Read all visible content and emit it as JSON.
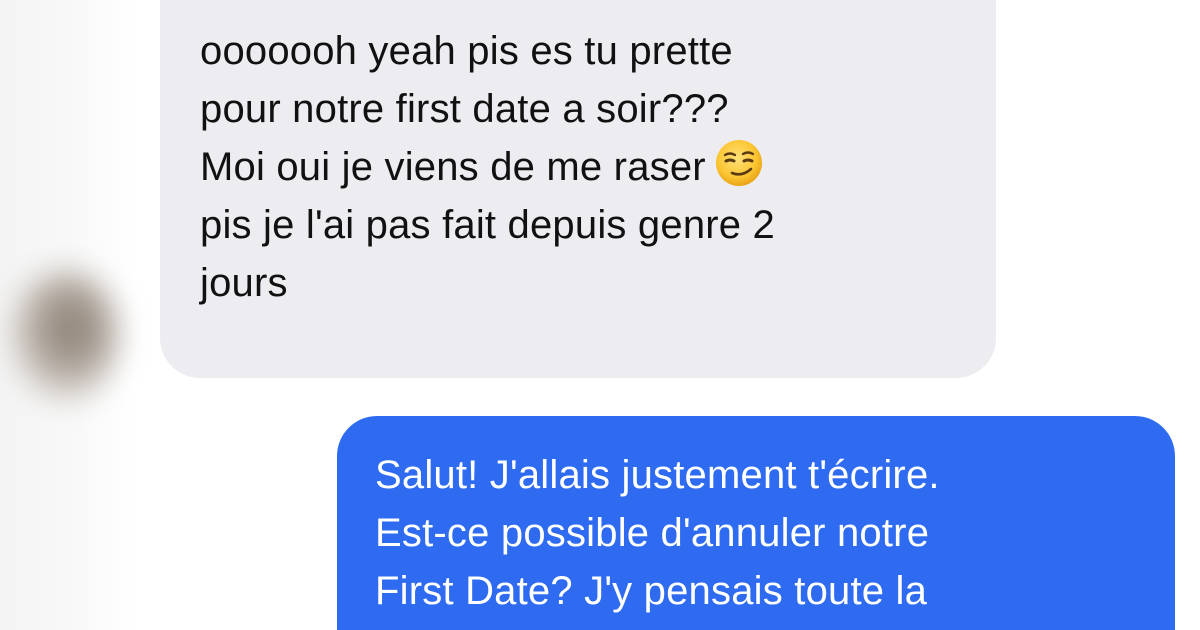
{
  "conversation": {
    "incoming": {
      "lines": [
        "ooooooh yeah pis es tu prette",
        "pour notre first date a soir???",
        "Moi oui je viens de me raser",
        "pis je l'ai pas fait depuis genre 2",
        "jours"
      ],
      "emoji": "smirking-face-icon"
    },
    "outgoing": {
      "lines": [
        "Salut! J'allais justement t'écrire.",
        "Est-ce possible d'annuler notre",
        "First Date? J'y pensais toute la"
      ]
    }
  },
  "colors": {
    "incoming_bubble": "#ededf1",
    "outgoing_bubble": "#2e6bf0",
    "incoming_text": "#111111",
    "outgoing_text": "#ffffff"
  }
}
